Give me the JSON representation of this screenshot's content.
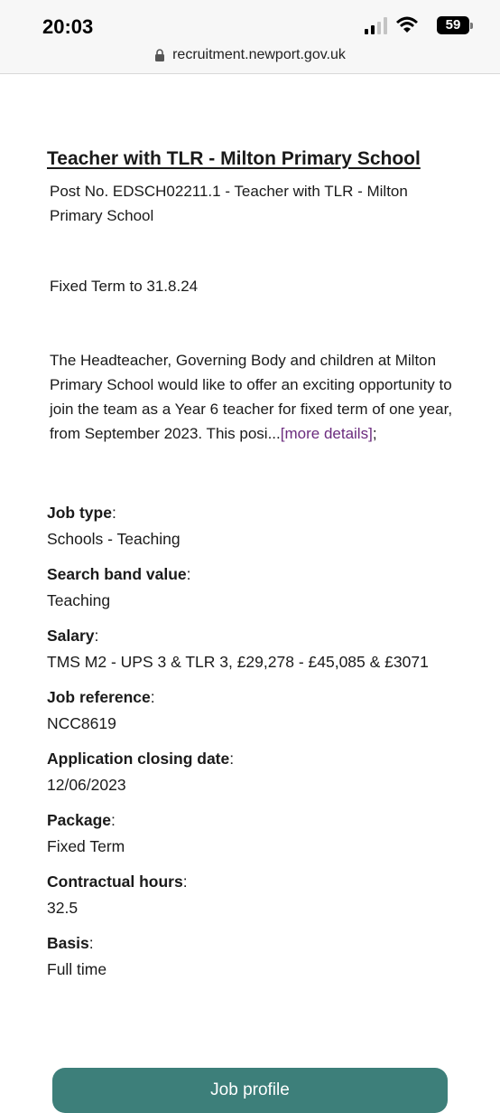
{
  "status_bar": {
    "time": "20:03",
    "battery": "59",
    "icons": [
      "signal-icon",
      "wifi-icon",
      "battery-icon"
    ]
  },
  "browser": {
    "url": "recruitment.newport.gov.uk",
    "icons": [
      "lock-icon"
    ]
  },
  "job": {
    "title": "Teacher with TLR - Milton Primary School",
    "post_no": "Post No. EDSCH02211.1 - Teacher with TLR - Milton Primary School",
    "term": "Fixed Term to 31.8.24",
    "summary": "The Headteacher, Governing Body and children at Milton Primary School would like to offer an exciting opportunity to join the team as a Year 6 teacher for fixed term of one year, from September 2023. This posi...",
    "more_link": "[more details]",
    "more_suffix": ";"
  },
  "details": [
    {
      "label": "Job type",
      "value": "Schools - Teaching"
    },
    {
      "label": "Search band value",
      "value": "Teaching"
    },
    {
      "label": "Salary",
      "value": "TMS M2 - UPS 3 & TLR 3, £29,278 - £45,085 & £3071"
    },
    {
      "label": "Job reference",
      "value": "NCC8619"
    },
    {
      "label": "Application closing date",
      "value": "12/06/2023"
    },
    {
      "label": "Package",
      "value": "Fixed Term"
    },
    {
      "label": "Contractual hours",
      "value": "32.5"
    },
    {
      "label": "Basis",
      "value": "Full time"
    }
  ],
  "colon": ":",
  "actions": {
    "job_profile_label": "Job profile"
  },
  "colors": {
    "link": "#6b2b7e",
    "button": "#3d7f7a"
  }
}
